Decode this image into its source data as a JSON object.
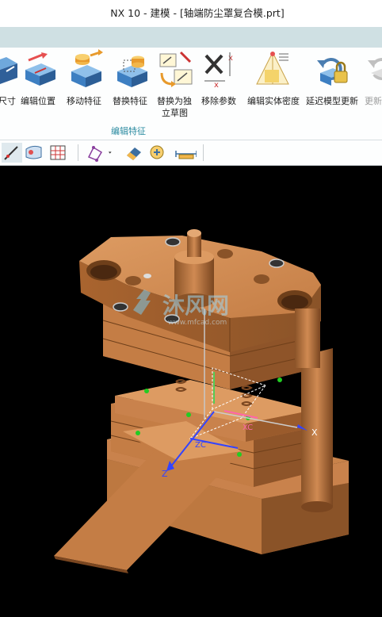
{
  "window": {
    "title": "NX 10 - 建模 - [轴端防尘罩复合模.prt]"
  },
  "ribbon": {
    "buttons": [
      {
        "label": "尺寸",
        "icon": "dimension-icon"
      },
      {
        "label": "编辑位置",
        "icon": "edit-position-icon"
      },
      {
        "label": "移动特征",
        "icon": "move-feature-icon"
      },
      {
        "label": "替换特征",
        "icon": "replace-feature-icon"
      },
      {
        "label_line1": "替换为独",
        "label_line2": "立草图",
        "icon": "replace-sketch-icon"
      },
      {
        "label": "移除参数",
        "icon": "remove-parameters-icon"
      },
      {
        "label": "编辑实体密度",
        "icon": "edit-density-icon"
      },
      {
        "label": "延迟模型更新",
        "icon": "delay-update-icon"
      },
      {
        "label": "更新",
        "icon": "update-icon"
      }
    ],
    "group_label": "编辑特征"
  },
  "toolbar": {
    "icons": [
      "curve-icon",
      "surface-icon",
      "grid-icon",
      "snap-icon",
      "dropdown-icon",
      "eraser-icon",
      "analysis-icon",
      "measure-icon"
    ]
  },
  "viewport": {
    "axes": {
      "x": "X",
      "z": "Z",
      "xc": "XC",
      "zc": "ZC"
    },
    "watermark": {
      "brand": "沐风网",
      "url": "www.mfcad.com"
    },
    "colors": {
      "mold_body": "#c9824c",
      "mold_dark": "#8a5328",
      "mold_light": "#dd9b62",
      "background": "#000000",
      "accent_green": "#22cc22",
      "axis_blue": "#3344ff"
    }
  }
}
